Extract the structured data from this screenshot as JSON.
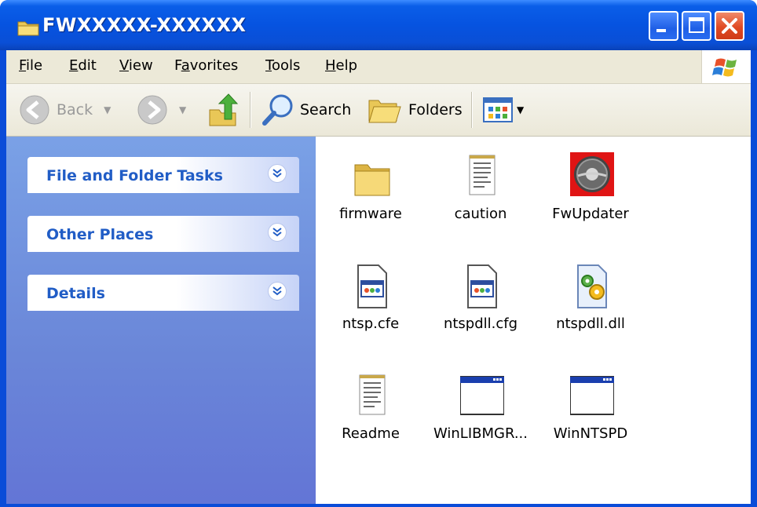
{
  "window": {
    "title": "FWXXXXX-XXXXXX"
  },
  "menu": [
    {
      "label": "File",
      "key": "F",
      "rest": "ile"
    },
    {
      "label": "Edit",
      "key": "E",
      "rest": "dit"
    },
    {
      "label": "View",
      "key": "V",
      "rest": "iew"
    },
    {
      "label": "Favorites",
      "pre": "F",
      "key": "a",
      "rest": "vorites"
    },
    {
      "label": "Tools",
      "key": "T",
      "rest": "ools"
    },
    {
      "label": "Help",
      "key": "H",
      "rest": "elp"
    }
  ],
  "toolbar": {
    "back_label": "Back",
    "search_label": "Search",
    "folders_label": "Folders"
  },
  "taskpane": {
    "panels": [
      {
        "title": "File and Folder Tasks"
      },
      {
        "title": "Other Places"
      },
      {
        "title": "Details"
      }
    ]
  },
  "files": [
    {
      "name": "firmware",
      "icon": "folder-icon"
    },
    {
      "name": "caution",
      "icon": "text-document-icon"
    },
    {
      "name": "FwUpdater",
      "icon": "application-icon"
    },
    {
      "name": "ntsp.cfe",
      "icon": "config-file-icon"
    },
    {
      "name": "ntspdll.cfg",
      "icon": "config-file-icon"
    },
    {
      "name": "ntspdll.dll",
      "icon": "dll-file-icon"
    },
    {
      "name": "Readme",
      "icon": "text-document-icon"
    },
    {
      "name": "WinLIBMGR...",
      "icon": "window-app-icon"
    },
    {
      "name": "WinNTSPD",
      "icon": "window-app-icon"
    }
  ],
  "colors": {
    "title_blue": "#0653e0",
    "taskpane_blue": "#6a86d8",
    "panel_text": "#215dc6",
    "close_red": "#e04a24"
  }
}
